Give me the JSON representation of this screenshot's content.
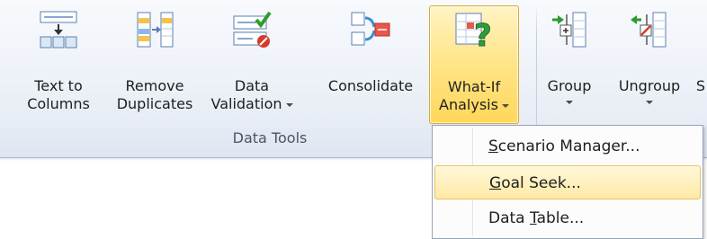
{
  "ribbon": {
    "group_title": "Data Tools",
    "buttons": [
      {
        "id": "text-to-columns",
        "line1": "Text to",
        "line2": "Columns"
      },
      {
        "id": "remove-duplicates",
        "line1": "Remove",
        "line2": "Duplicates"
      },
      {
        "id": "data-validation",
        "line1": "Data",
        "line2": "Validation"
      },
      {
        "id": "consolidate",
        "line1": "Consolidate",
        "line2": ""
      },
      {
        "id": "what-if-analysis",
        "line1": "What-If",
        "line2": "Analysis"
      },
      {
        "id": "group",
        "line1": "Group",
        "line2": ""
      },
      {
        "id": "ungroup",
        "line1": "Ungroup",
        "line2": ""
      },
      {
        "id": "subtotal-partial",
        "line1": "S",
        "line2": ""
      }
    ]
  },
  "menu": {
    "items": [
      {
        "pre": "",
        "accel": "S",
        "post": "cenario Manager...",
        "state": "normal"
      },
      {
        "pre": "",
        "accel": "G",
        "post": "oal Seek...",
        "state": "hover"
      },
      {
        "pre": "Data ",
        "accel": "T",
        "post": "able...",
        "state": "normal"
      }
    ]
  },
  "colors": {
    "active_button": "#ffd75a",
    "menu_hover": "#ffe9a6",
    "ribbon_bg": "#e9eef6"
  },
  "icons": [
    "text-to-columns-icon",
    "remove-duplicates-icon",
    "data-validation-icon",
    "consolidate-icon",
    "what-if-analysis-icon",
    "group-icon",
    "ungroup-icon"
  ]
}
